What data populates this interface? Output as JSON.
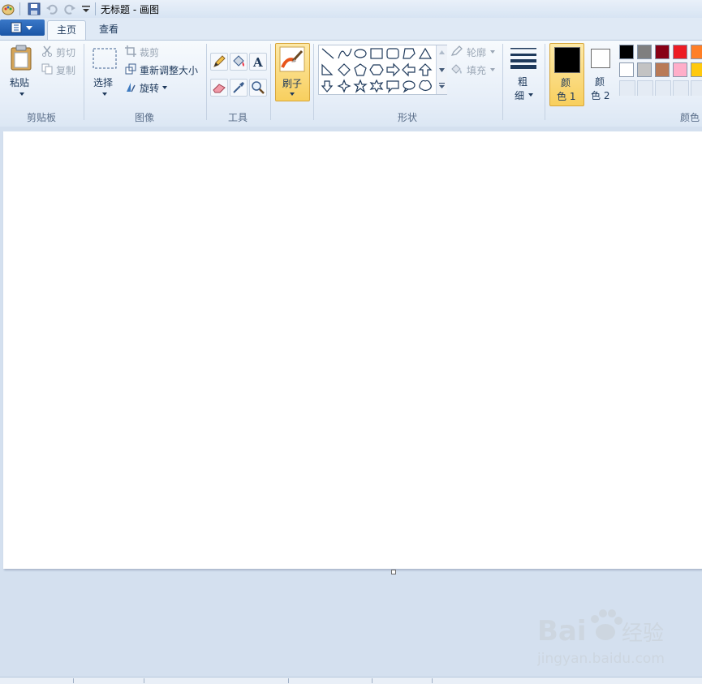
{
  "window": {
    "title": "无标题 - 画图"
  },
  "tabs": [
    {
      "label": "主页"
    },
    {
      "label": "查看"
    }
  ],
  "clipboard": {
    "paste": "粘贴",
    "cut": "剪切",
    "copy": "复制",
    "group": "剪贴板"
  },
  "image": {
    "select": "选择",
    "crop": "裁剪",
    "resize": "重新调整大小",
    "rotate": "旋转",
    "group": "图像"
  },
  "tools": {
    "group": "工具"
  },
  "brushes": {
    "label": "刷子"
  },
  "shapes": {
    "outline": "轮廓",
    "fill": "填充",
    "group": "形状"
  },
  "size": {
    "line1": "粗",
    "line2": "细"
  },
  "colors": {
    "color1_line1": "颜",
    "color1_line2": "色 1",
    "color2_line1": "颜",
    "color2_line2": "色 2",
    "group": "颜色",
    "color1_value": "#000000",
    "color2_value": "#ffffff",
    "palette_row1": [
      "#000000",
      "#7f7f7f",
      "#880015",
      "#ed1c24",
      "#ff7f27"
    ],
    "palette_row2": [
      "#ffffff",
      "#c3c3c3",
      "#b97a57",
      "#ffaec9",
      "#ffc90e"
    ]
  },
  "watermark": {
    "brand": "Bai 经验",
    "url": "jingyan.baidu.com"
  }
}
